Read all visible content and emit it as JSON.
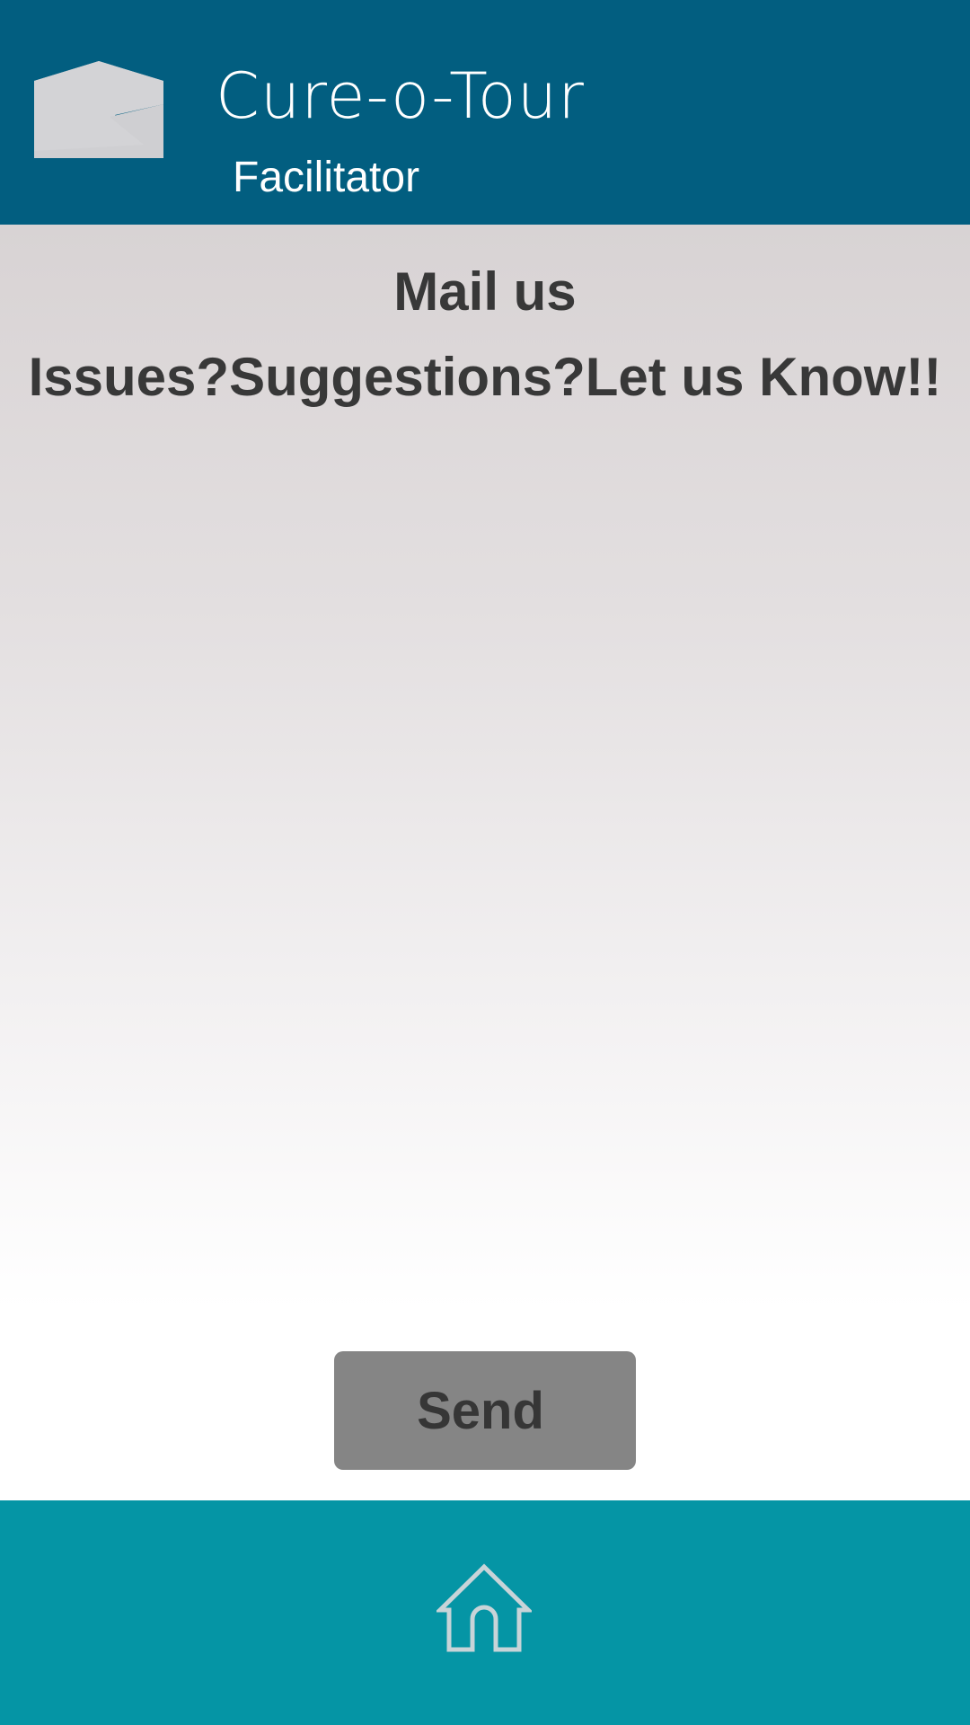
{
  "header": {
    "title": "Cure-o-Tour",
    "subtitle": "Facilitator",
    "icon": "mail-envelope-icon",
    "background_color": "#025e80"
  },
  "main": {
    "heading": "Mail us",
    "subheading": "Issues?Suggestions?Let us Know!!"
  },
  "actions": {
    "send_label": "Send"
  },
  "footer": {
    "home_icon": "home-icon",
    "background_color": "#0595a5"
  }
}
